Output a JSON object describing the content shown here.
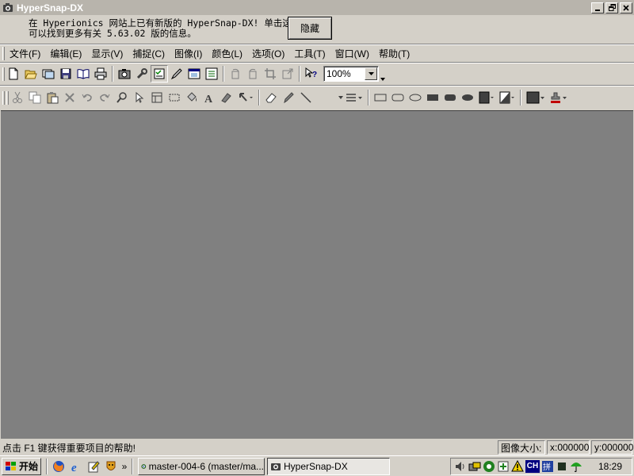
{
  "window": {
    "title": "HyperSnap-DX"
  },
  "notification": {
    "line1": "在 Hyperionics 网站上已有新版的 HyperSnap-DX! 单击这里",
    "line2": "可以找到更多有关 5.63.02 版的信息。",
    "hide_label": "隐藏"
  },
  "menubar": {
    "items": [
      {
        "label": "文件(F)"
      },
      {
        "label": "编辑(E)"
      },
      {
        "label": "显示(V)"
      },
      {
        "label": "捕捉(C)"
      },
      {
        "label": "图像(I)"
      },
      {
        "label": "颜色(L)"
      },
      {
        "label": "选项(O)"
      },
      {
        "label": "工具(T)"
      },
      {
        "label": "窗口(W)"
      },
      {
        "label": "帮助(T)"
      }
    ]
  },
  "toolbar": {
    "zoom_value": "100%"
  },
  "statusbar": {
    "hint": "点击 F1 键获得重要项目的帮助!",
    "image_size_label": "图像大小:",
    "x_coord": "x:000000",
    "y_coord": "y:000000"
  },
  "taskbar": {
    "start_label": "开始",
    "chevron": "»",
    "tasks": [
      {
        "label": "master-004-6 (master/ma..."
      },
      {
        "label": "HyperSnap-DX"
      }
    ],
    "tray_ime": "CH",
    "clock": "18:29"
  },
  "colors": {
    "workspace": "#808080",
    "chrome": "#d4d0c8",
    "titlebar_inactive": "#b8b4ac"
  }
}
